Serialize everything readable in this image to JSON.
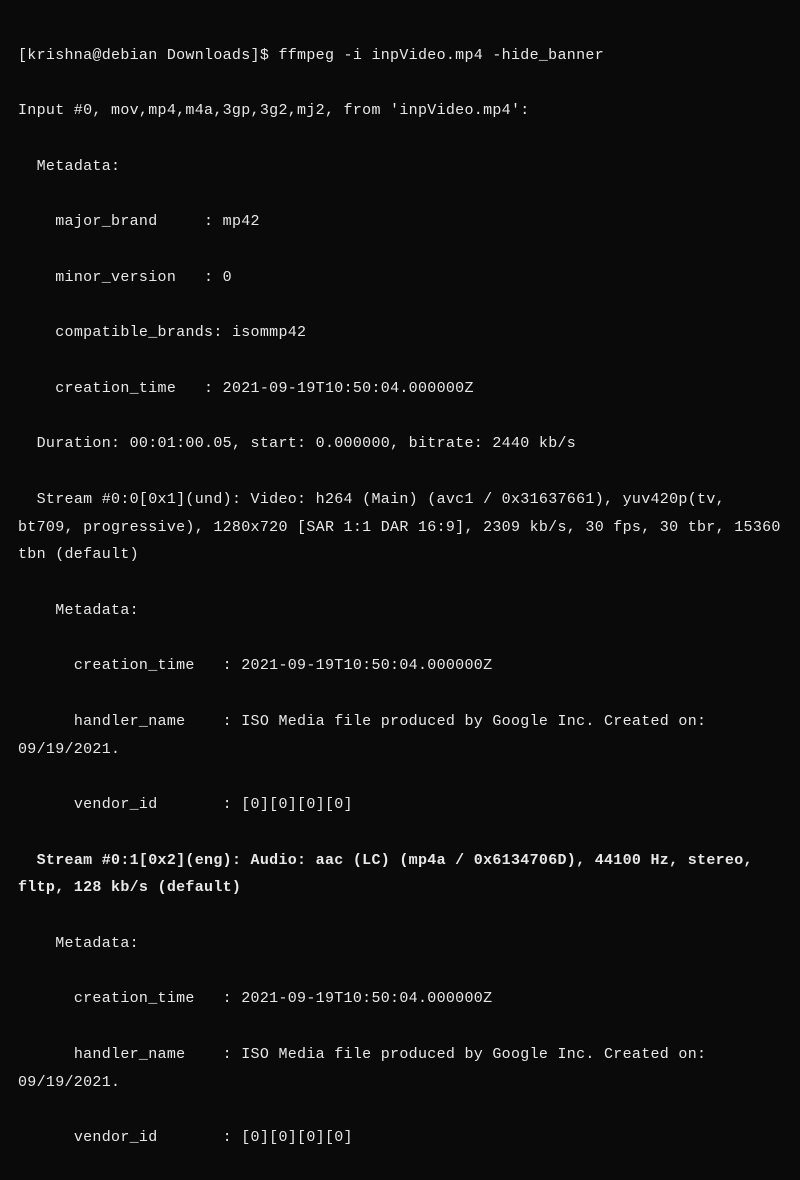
{
  "prompt": "[krishna@debian Downloads]$ ffmpeg -i inpVideo.mp4 -hide_banner",
  "input_header": "Input #0, mov,mp4,m4a,3gp,3g2,mj2, from 'inpVideo.mp4':",
  "metadata_label": "  Metadata:",
  "major_brand": "    major_brand     : mp42",
  "minor_version": "    minor_version   : 0",
  "compatible": "    compatible_brands: isommp42",
  "creation_time_1": "    creation_time   : 2021-09-19T10:50:04.000000Z",
  "duration": "  Duration: 00:01:00.05, start: 0.000000, bitrate: 2440 kb/s",
  "stream_video_1": "  Stream #0:0[0x1](und): Video: h264 (Main) (avc1 / 0x31637661), yuv420p(tv, bt709, progressive), 1280x720 [SAR 1:1 DAR 16:9], 2309 kb/s, 30 fps, 30 tbr, 15360 tbn (default)",
  "metadata_label_2": "    Metadata:",
  "creation_time_2": "      creation_time   : 2021-09-19T10:50:04.000000Z",
  "handler_1": "      handler_name    : ISO Media file produced by Google Inc. Created on: 09/19/2021.",
  "vendor_1": "      vendor_id       : [0][0][0][0]",
  "stream_audio": "  Stream #0:1[0x2](eng): Audio: aac (LC) (mp4a / 0x6134706D), 44100 Hz, stereo, fltp, 128 kb/s (default)",
  "metadata_label_3": "    Metadata:",
  "creation_time_3": "      creation_time   : 2021-09-19T10:50:04.000000Z",
  "handler_2": "      handler_name    : ISO Media file produced by Google Inc. Created on: 09/19/2021.",
  "vendor_2": "      vendor_id       : [0][0][0][0]"
}
